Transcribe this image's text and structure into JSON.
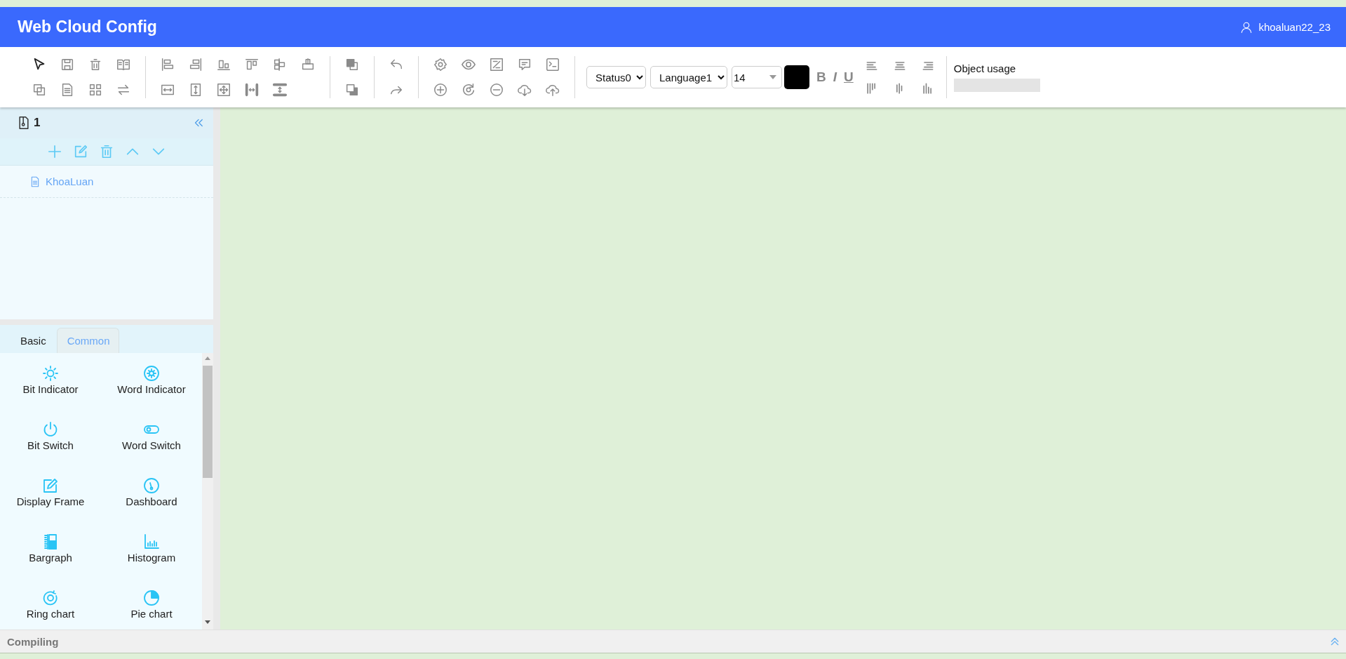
{
  "header": {
    "title": "Web Cloud Config",
    "user": "khoaluan22_23"
  },
  "toolbar": {
    "status_select": "Status0",
    "language_select": "Language1",
    "font_size": "14",
    "format_buttons": [
      {
        "kind": "bold",
        "label": "B",
        "active": false
      },
      {
        "kind": "italic",
        "label": "I",
        "active": false
      },
      {
        "kind": "underline",
        "label": "U",
        "active": false
      }
    ],
    "object_usage": {
      "label": "Object usage",
      "level": 0
    }
  },
  "project": {
    "title": "1",
    "tree": [
      {
        "label": "KhoaLuan",
        "selected": false
      }
    ]
  },
  "palette": {
    "tabs": [
      {
        "label": "Basic",
        "selected": false
      },
      {
        "label": "Common",
        "selected": true
      }
    ],
    "items": [
      {
        "label": "Bit Indicator"
      },
      {
        "label": "Word Indicator"
      },
      {
        "label": "Bit Switch"
      },
      {
        "label": "Word Switch"
      },
      {
        "label": "Display Frame"
      },
      {
        "label": "Dashboard"
      },
      {
        "label": "Bargraph"
      },
      {
        "label": "Histogram"
      },
      {
        "label": "Ring chart"
      },
      {
        "label": "Pie chart"
      }
    ]
  },
  "status_bar": {
    "title": "Compiling"
  }
}
